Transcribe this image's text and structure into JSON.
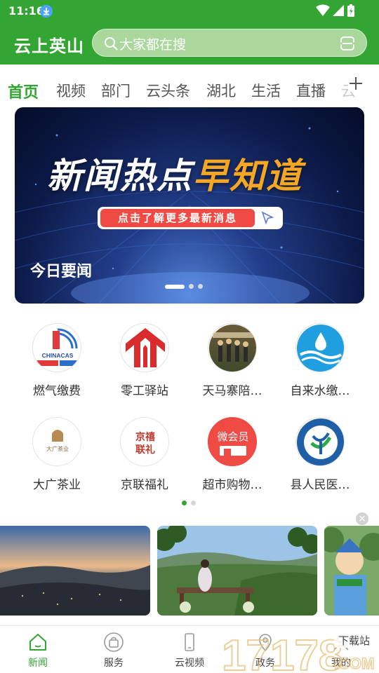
{
  "status_bar": {
    "time": "11:16"
  },
  "header": {
    "app_title": "云上英山",
    "search_placeholder": "大家都在搜"
  },
  "tabs": [
    "首页",
    "视频",
    "部门",
    "云头条",
    "湖北",
    "生活",
    "直播",
    "云"
  ],
  "banner": {
    "headline_part1": "新闻热点",
    "headline_part2": "早知道",
    "pill_text": "点击了解更多最新消息",
    "caption": "今日要闻"
  },
  "services": [
    {
      "label": "燃气缴费",
      "logo_text": "CHINACAS"
    },
    {
      "label": "零工驿站"
    },
    {
      "label": "天马寨陪…"
    },
    {
      "label": "自来水缴…"
    },
    {
      "label": "大广茶业",
      "logo_text": "大广茶业"
    },
    {
      "label": "京联福礼",
      "logo_text": "京禧联礼"
    },
    {
      "label": "超市购物…",
      "logo_text": "微会员"
    },
    {
      "label": "县人民医…"
    }
  ],
  "bottom_nav": [
    "新闻",
    "服务",
    "云视频",
    "政务",
    "我的"
  ],
  "watermark": {
    "text": "17178",
    "sub_text": "下载站",
    "suffix": ".COM"
  },
  "colors": {
    "brand_green": "#33a532",
    "banner_red": "#ef4a43",
    "banner_orange": "#f5a623"
  }
}
